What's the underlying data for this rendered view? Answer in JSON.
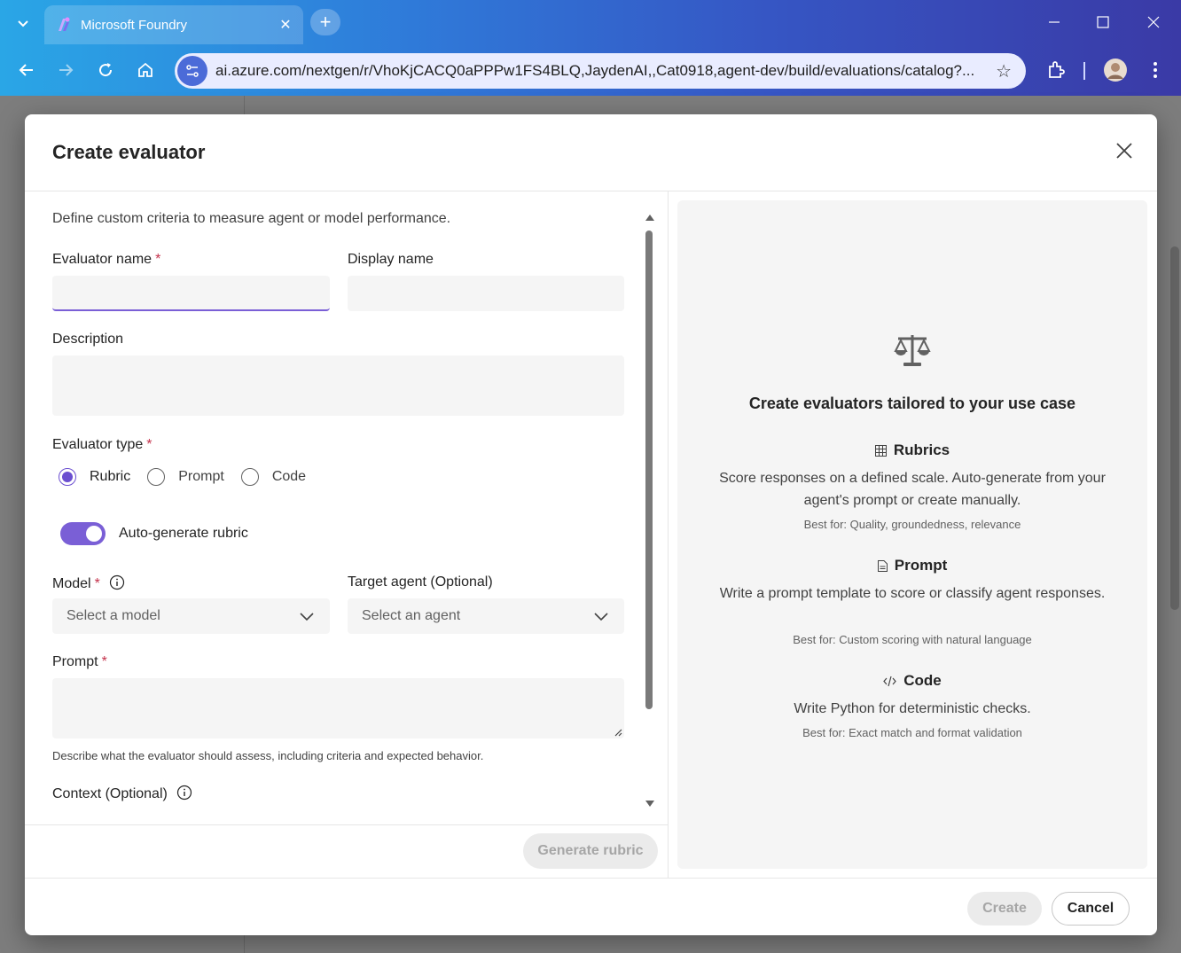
{
  "browser": {
    "tab_title": "Microsoft Foundry",
    "url": "ai.azure.com/nextgen/r/VhoKjCACQ0aPPPw1FS4BLQ,JaydenAI,,Cat0918,agent-dev/build/evaluations/catalog?..."
  },
  "dialog": {
    "title": "Create evaluator",
    "intro": "Define custom criteria to measure agent or model performance.",
    "evaluator_name_label": "Evaluator name",
    "display_name_label": "Display name",
    "description_label": "Description",
    "evaluator_type_label": "Evaluator type",
    "required_mark": "*",
    "types": [
      "Rubric",
      "Prompt",
      "Code"
    ],
    "selected_type": "Rubric",
    "auto_generate_label": "Auto-generate rubric",
    "auto_generate_on": true,
    "model_label": "Model",
    "model_placeholder": "Select a model",
    "target_agent_label": "Target agent (Optional)",
    "target_agent_placeholder": "Select an agent",
    "prompt_label": "Prompt",
    "prompt_helper": "Describe what the evaluator should assess, including criteria and expected behavior.",
    "context_label": "Context (Optional)",
    "generate_button": "Generate rubric",
    "create_button": "Create",
    "cancel_button": "Cancel"
  },
  "panel": {
    "title": "Create evaluators tailored to your use case",
    "sections": [
      {
        "icon": "table-icon",
        "heading": "Rubrics",
        "description": "Score responses on a defined scale. Auto-generate from your agent's prompt or create manually.",
        "best_for": "Best for: Quality, groundedness, relevance"
      },
      {
        "icon": "document-icon",
        "heading": "Prompt",
        "description": "Write a prompt template to score or classify agent responses.",
        "best_for": "Best for: Custom scoring with natural language"
      },
      {
        "icon": "code-icon",
        "heading": "Code",
        "description": "Write Python for deterministic checks.",
        "best_for": "Best for: Exact match and format validation"
      }
    ]
  },
  "colors": {
    "accent": "#7a5fd6",
    "required": "#c4314b"
  }
}
